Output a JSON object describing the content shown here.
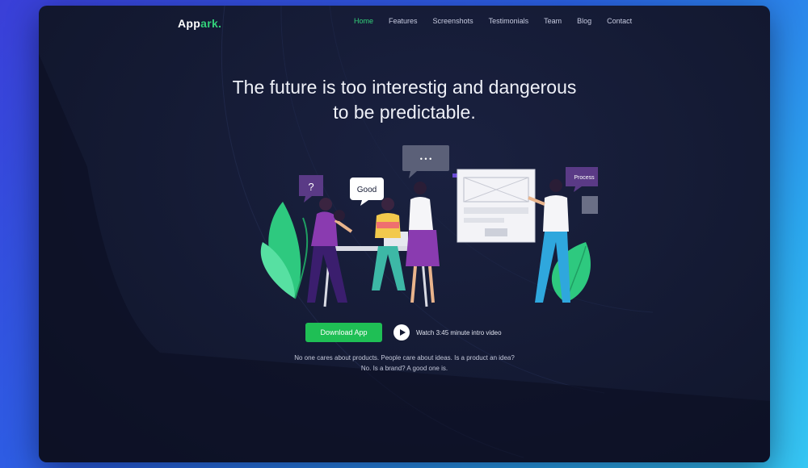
{
  "brand": {
    "logo_main": "App",
    "logo_accent": "ark."
  },
  "nav": {
    "items": [
      {
        "label": "Home",
        "active": true
      },
      {
        "label": "Features",
        "active": false
      },
      {
        "label": "Screenshots",
        "active": false
      },
      {
        "label": "Testimonials",
        "active": false
      },
      {
        "label": "Team",
        "active": false
      },
      {
        "label": "Blog",
        "active": false
      },
      {
        "label": "Contact",
        "active": false
      }
    ]
  },
  "hero": {
    "title_line1": "The future is too interestig and dangerous",
    "title_line2": "to be predictable.",
    "download_label": "Download App",
    "watch_label": "Watch 3:45 minute intro video",
    "sub_line1": "No one cares about products. People care about ideas. Is a product an idea?",
    "sub_line2": "No. Is a brand? A good one is."
  },
  "illustration": {
    "bubble_question": "?",
    "bubble_good": "Good",
    "bubble_process": "Process",
    "bubble_dots": "• • •"
  },
  "colors": {
    "accent_green": "#1fbf55",
    "nav_active": "#33d17a",
    "panel_bg": "#141a33"
  }
}
